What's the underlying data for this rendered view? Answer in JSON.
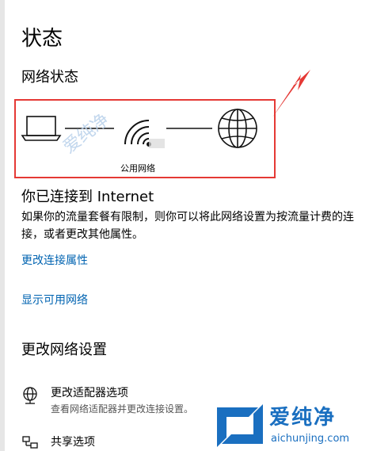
{
  "page": {
    "title": "状态"
  },
  "network_status": {
    "heading": "网络状态",
    "network_label": "公用网络",
    "icons": [
      "laptop-icon",
      "wifi-icon",
      "globe-icon"
    ]
  },
  "connection": {
    "title": "你已连接到 Internet",
    "description": "如果你的流量套餐有限制，则你可以将此网络设置为按流量计费的连接，或者更改其他属性。"
  },
  "links": {
    "change_properties": "更改连接属性",
    "show_networks": "显示可用网络"
  },
  "change_settings": {
    "heading": "更改网络设置",
    "options": [
      {
        "icon": "adapter-globe-icon",
        "title": "更改适配器选项",
        "description": "查看网络适配器并更改连接设置。"
      },
      {
        "icon": "sharing-icon",
        "title": "共享选项"
      }
    ]
  },
  "watermark": {
    "brand": "爱纯净",
    "url": "aichunjing.com",
    "faint_text": "爱纯净"
  },
  "colors": {
    "link": "#0063b1",
    "highlight_border": "#e53935",
    "watermark": "#1a6fc0"
  }
}
